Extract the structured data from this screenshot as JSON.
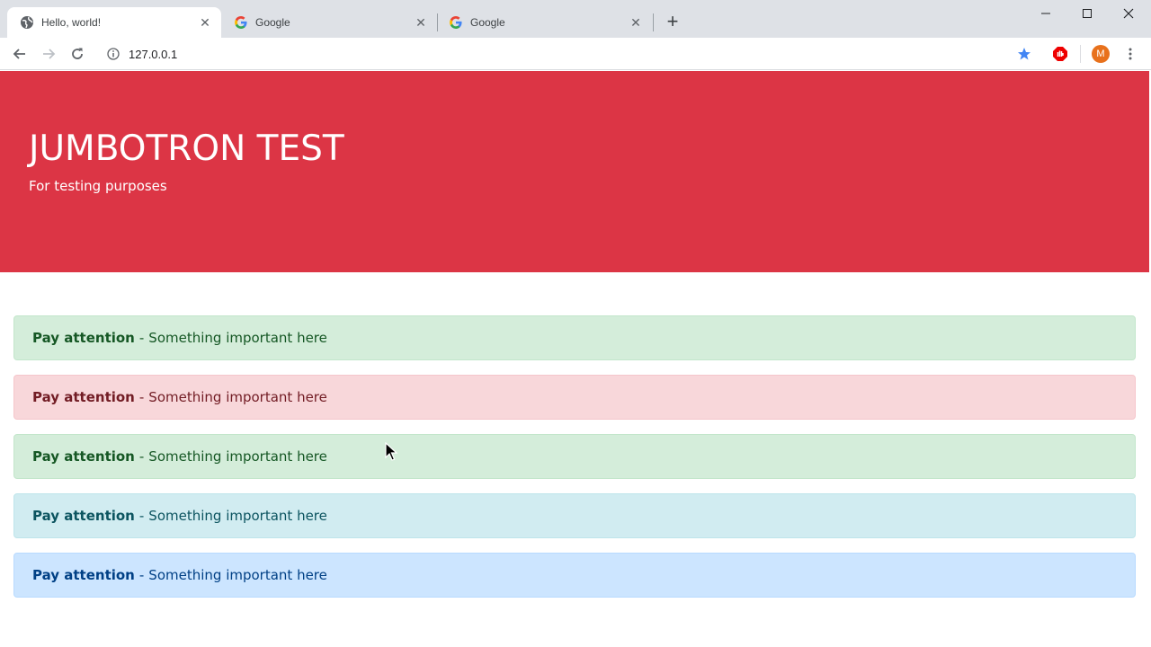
{
  "browser": {
    "tabs": [
      {
        "title": "Hello, world!",
        "active": true,
        "favicon": "globe-icon"
      },
      {
        "title": "Google",
        "active": false,
        "favicon": "google-icon"
      },
      {
        "title": "Google",
        "active": false,
        "favicon": "google-icon"
      }
    ],
    "address": "127.0.0.1",
    "profile_initial": "M"
  },
  "jumbotron": {
    "title": "JUMBOTRON TEST",
    "subtitle": "For testing purposes",
    "bg_color": "#dc3545"
  },
  "alerts": [
    {
      "variant": "success",
      "strong": "Pay attention",
      "text": "Something important here"
    },
    {
      "variant": "danger",
      "strong": "Pay attention",
      "text": "Something important here"
    },
    {
      "variant": "success",
      "strong": "Pay attention",
      "text": "Something important here"
    },
    {
      "variant": "info",
      "strong": "Pay attention",
      "text": "Something important here"
    },
    {
      "variant": "primary",
      "strong": "Pay attention",
      "text": "Something important here"
    }
  ],
  "alert_separator": "-"
}
